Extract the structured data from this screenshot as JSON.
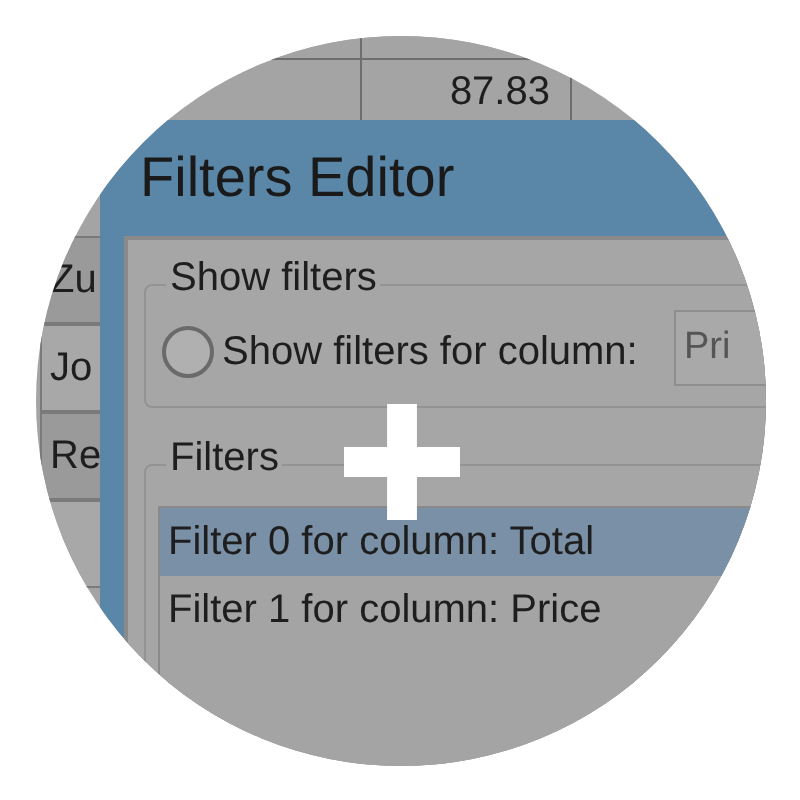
{
  "background_table": {
    "top_row": {
      "value": "87.83"
    },
    "left_column": [
      "Zu",
      "Jo",
      "Re"
    ]
  },
  "dialog": {
    "title": "Filters Editor",
    "show_filters": {
      "label": "Show filters",
      "radio": {
        "label": "Show filters for column:",
        "selected": false
      },
      "column_field": {
        "value": "Pri"
      }
    },
    "filters": {
      "label": "Filters",
      "items": [
        {
          "label": "Filter 0 for column: Total",
          "selected": true
        },
        {
          "label": "Filter 1 for column: Price",
          "selected": false
        }
      ]
    }
  }
}
